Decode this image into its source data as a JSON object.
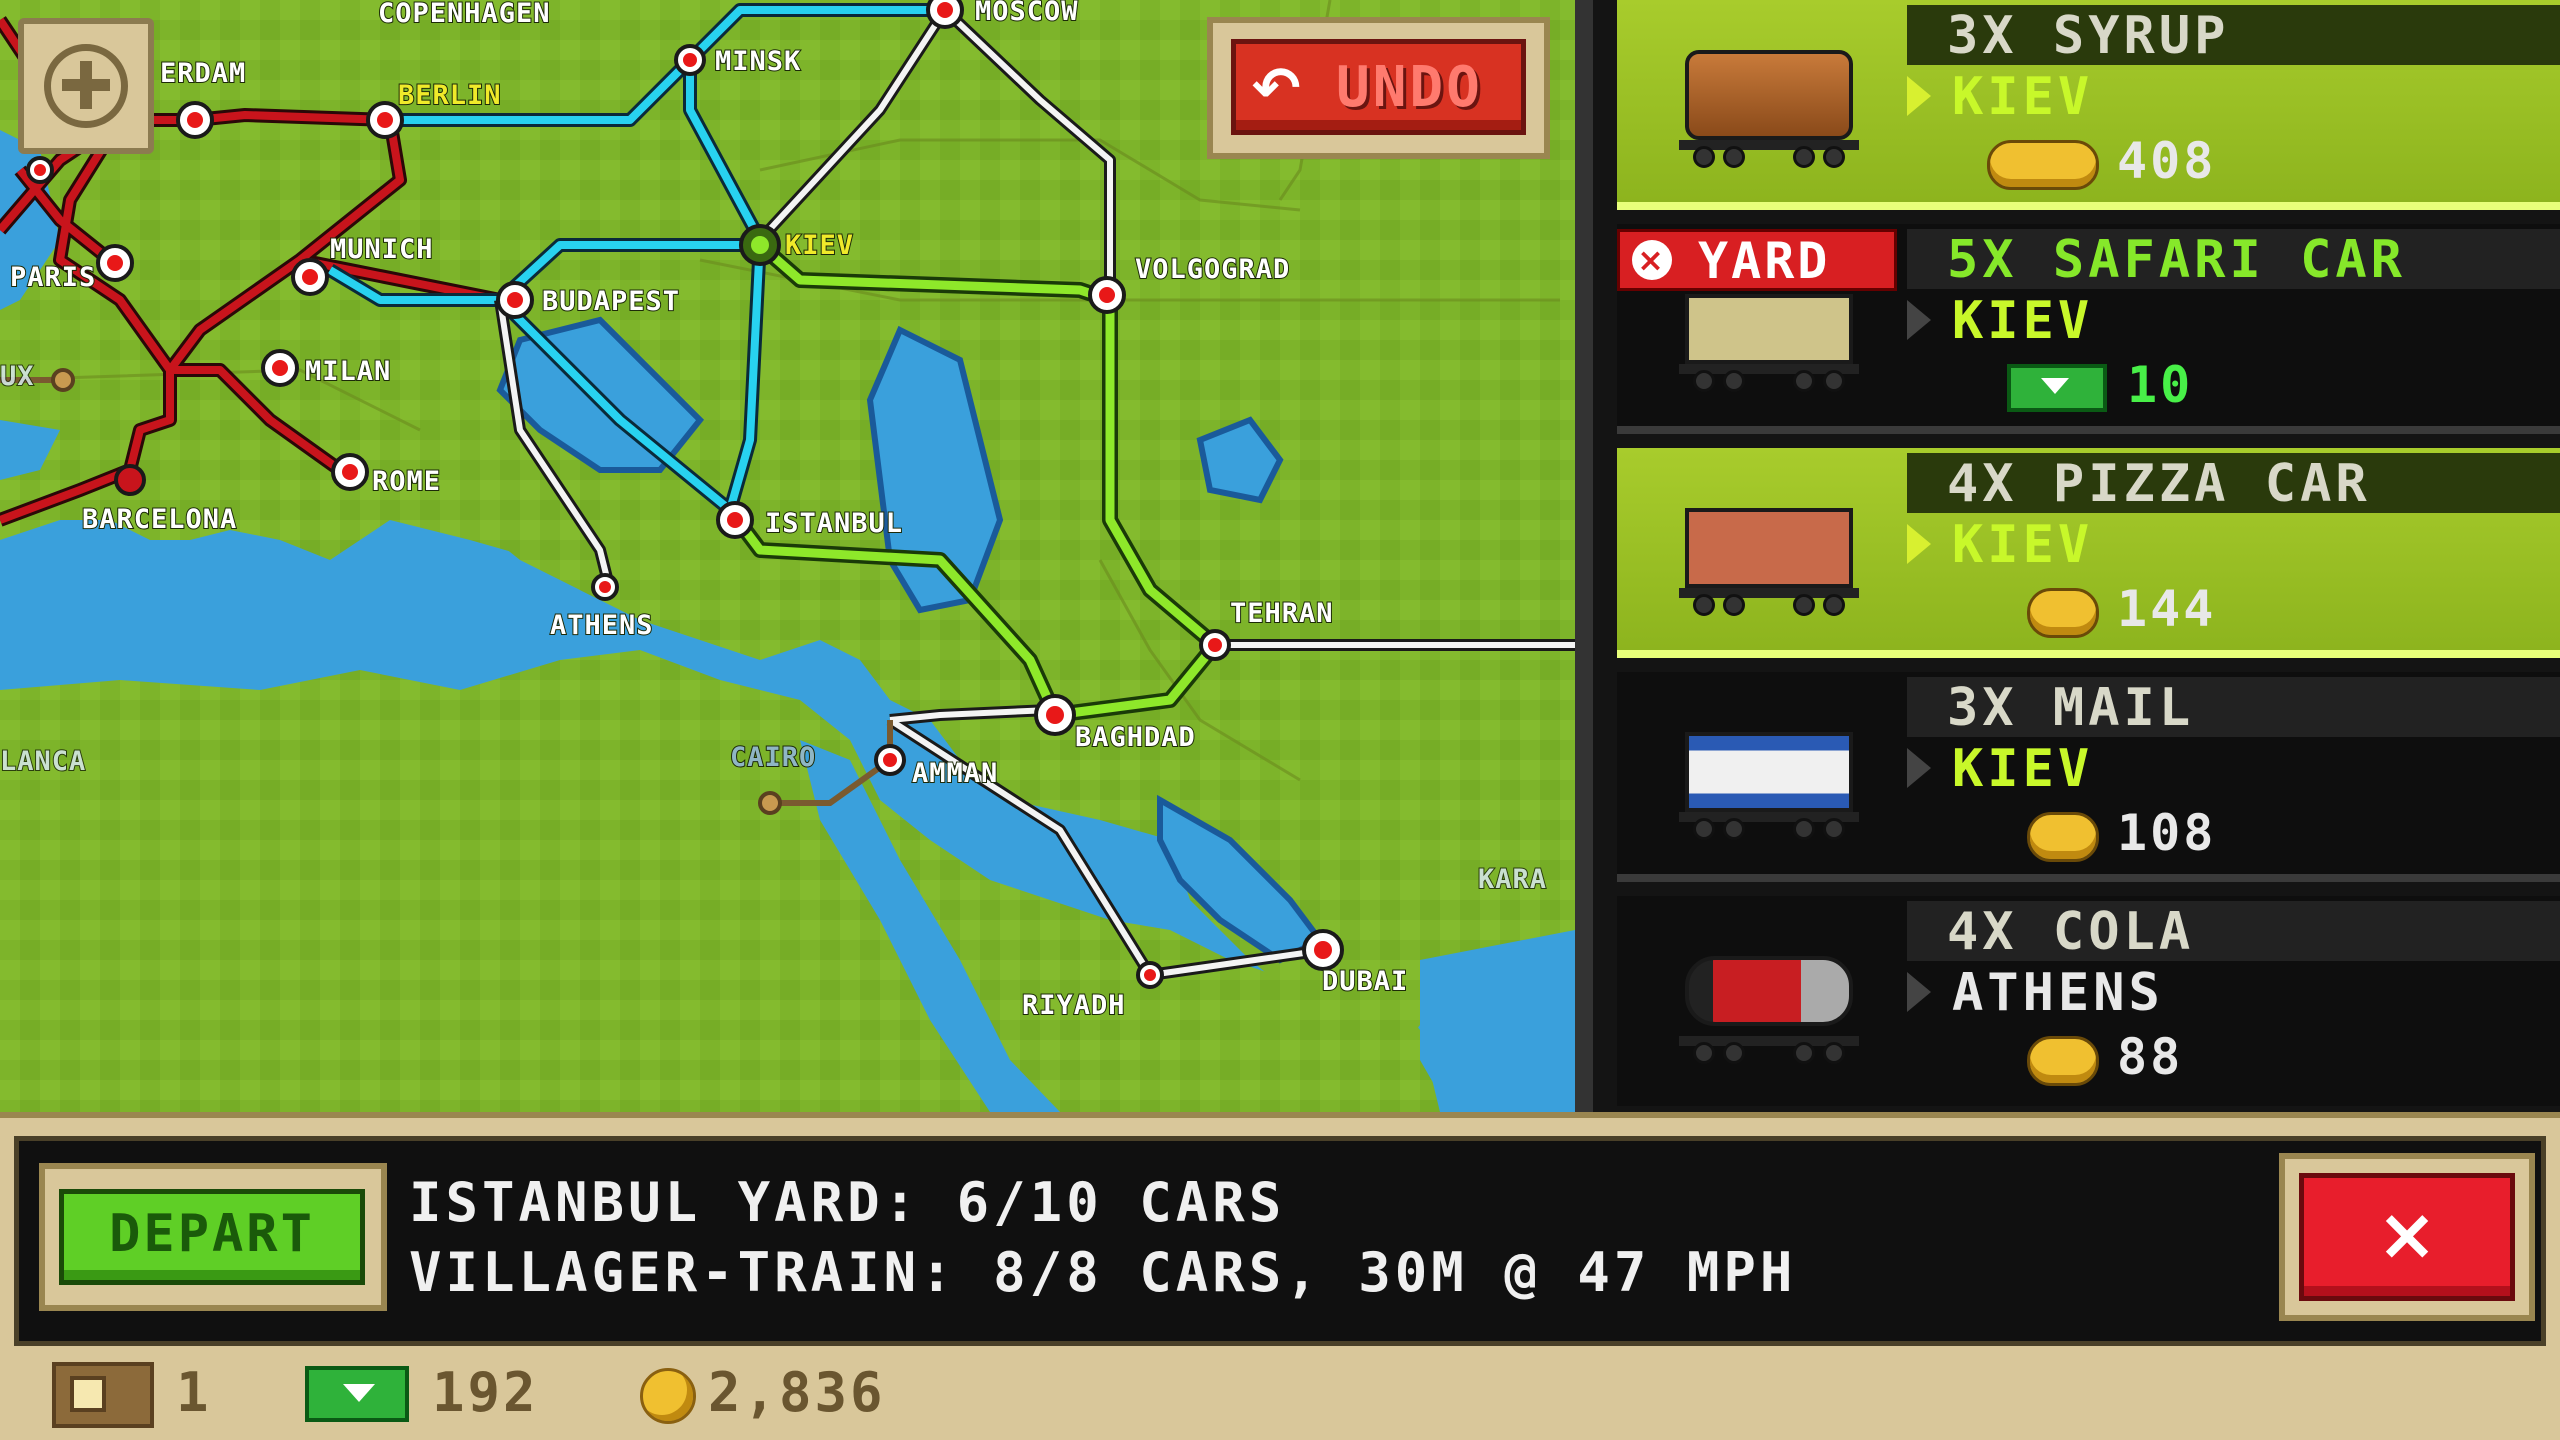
{
  "map": {
    "cities": {
      "copenhagen": "COPENHAGEN",
      "moscow": "MOSCOW",
      "amsterdam": "ERDAM",
      "berlin": "BERLIN",
      "minsk": "MINSK",
      "paris": "PARIS",
      "munich": "MUNICH",
      "kiev": "KIEV",
      "volgograd": "VOLGOGRAD",
      "budapest": "BUDAPEST",
      "milan": "MILAN",
      "lux": "UX",
      "rome": "ROME",
      "barcelona": "BARCELONA",
      "istanbul": "ISTANBUL",
      "athens": "ATHENS",
      "tehran": "TEHRAN",
      "casablanca": "LANCA",
      "cairo": "CAIRO",
      "amman": "AMMAN",
      "baghdad": "BAGHDAD",
      "karachi": "KARA",
      "riyadh": "RIYADH",
      "dubai": "DUBAI"
    },
    "undo_label": "UNDO",
    "undo_icon": "undo-arrow-icon",
    "zoom_icon": "zoom-in-plus-icon"
  },
  "cargo_list": [
    {
      "title": "3X SYRUP",
      "destination": "KIEV",
      "reward": "408",
      "reward_type": "coin",
      "style": "green",
      "car": "tank-car"
    },
    {
      "badge": "YARD",
      "title": "5X SAFARI CAR",
      "destination": "KIEV",
      "reward": "10",
      "reward_type": "cash",
      "style": "dark",
      "car": "safari-car"
    },
    {
      "title": "4X PIZZA CAR",
      "destination": "KIEV",
      "reward": "144",
      "reward_type": "coin",
      "style": "green",
      "car": "pizza-car"
    },
    {
      "title": "3X MAIL",
      "destination": "KIEV",
      "reward": "108",
      "reward_type": "coin",
      "style": "dark",
      "car": "mail-car"
    },
    {
      "title": "4X COLA",
      "destination": "ATHENS",
      "reward": "88",
      "reward_type": "coin",
      "style": "dark",
      "car": "cola-car"
    }
  ],
  "bottom": {
    "depart_label": "DEPART",
    "yard_line": "ISTANBUL YARD: 6/10 CARS",
    "train_line": "VILLAGER-TRAIN: 8/8 CARS, 30M @ 47 MPH",
    "close_label": "×"
  },
  "resources": {
    "tiles": "1",
    "cash": "192",
    "coins": "2,836"
  },
  "colors": {
    "land": "#7db42a",
    "water": "#3aa0dc",
    "card_green": "#a8cc2c",
    "line_red": "#c8141c",
    "line_cyan": "#28d2f0",
    "line_green": "#8ee82a"
  }
}
